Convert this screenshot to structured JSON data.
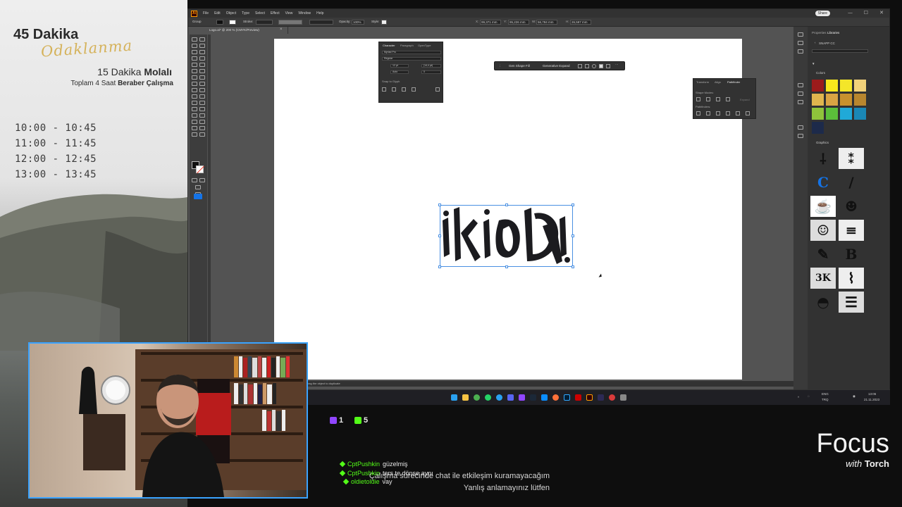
{
  "overlay": {
    "brand_title": "45 Dakika",
    "brand_script": "Odaklanma",
    "sub1_prefix": "15 Dakika ",
    "sub1_bold": "Molalı",
    "sub2_prefix": "Toplam 4 Saat ",
    "sub2_bold": "Beraber Çalışma",
    "schedule": [
      "10:00 - 10:45",
      "11:00 - 11:45",
      "12:00 - 12:45",
      "13:00 - 13:45"
    ]
  },
  "illustrator": {
    "menu": [
      "File",
      "Edit",
      "Object",
      "Type",
      "Select",
      "Effect",
      "View",
      "Window",
      "Help"
    ],
    "share_label": "Share",
    "control": {
      "group": "Group",
      "stroke": "Stroke:",
      "opacity_label": "Opacity:",
      "opacity_value": "100%",
      "style": "Style:",
      "x_value": "99,371 mm",
      "y_value": "95,226 mm",
      "w_value": "56,784 mm",
      "h_value": "26,597 mm"
    },
    "doc_tab": "Logo.ai* @ 200 % (CMYK/Preview)",
    "doc_close": "×",
    "character_panel": {
      "tabs": [
        "Character",
        "Paragraph",
        "OpenType"
      ],
      "font": "Myriad Pro",
      "style": "Regular",
      "size": "12 pt",
      "leading": "(14,4 pt)",
      "kerning": "Auto",
      "tracking": "0",
      "snap": "Snap to Glyph"
    },
    "context_bar": {
      "gen_shape_fill": "Gen Shape Fill",
      "generative_expand": "Generative Expand"
    },
    "pathfinder_panel": {
      "tabs": [
        "Transform",
        "Align",
        "Pathfinder"
      ],
      "shape_modes": "Shape Modes:",
      "expand": "Expand",
      "pathfinders": "Pathfinders:"
    },
    "status_text": "Drag the object to duplicate",
    "right_panel": {
      "tabs": [
        "Properties",
        "Libraries"
      ],
      "library_name": "SNAPP CC",
      "colors_head": "Colors",
      "graphics_head": "Graphics",
      "swatches": [
        "#9b1b1b",
        "#f7e81c",
        "#f4e629",
        "#f2d27a",
        "#e0b64e",
        "#d9a443",
        "#c7912e",
        "#b8862e",
        "#8fc43b",
        "#5bbf3a",
        "#20a9d8",
        "#1a87b5",
        "#1d2a4a"
      ]
    }
  },
  "taskbar": {
    "lang": "ENG",
    "lang2": "TRQ",
    "time": "13:06",
    "date": "21.11.2023"
  },
  "stream": {
    "counter_a": "1",
    "counter_b": "5",
    "chat": [
      {
        "user": "CptPushkin",
        "msg": "güzelmiş"
      },
      {
        "user": "CptPushkin",
        "msg": "ters te dönse aynı"
      },
      {
        "user": "oldietoldie",
        "msg": "vay"
      }
    ],
    "notice_line1": "Çalışma sürecinde chat ile etkileşim kuramayacağım",
    "notice_line2": "Yanlış anlamayınız lütfen",
    "focus_title": "Focus",
    "focus_with": "with",
    "focus_torch": "Torch"
  },
  "colors": {
    "accent_blue": "#1473e6",
    "kick_green": "#53fc18",
    "twitch_purple": "#9146ff",
    "webcam_border": "#3aa3ff"
  }
}
